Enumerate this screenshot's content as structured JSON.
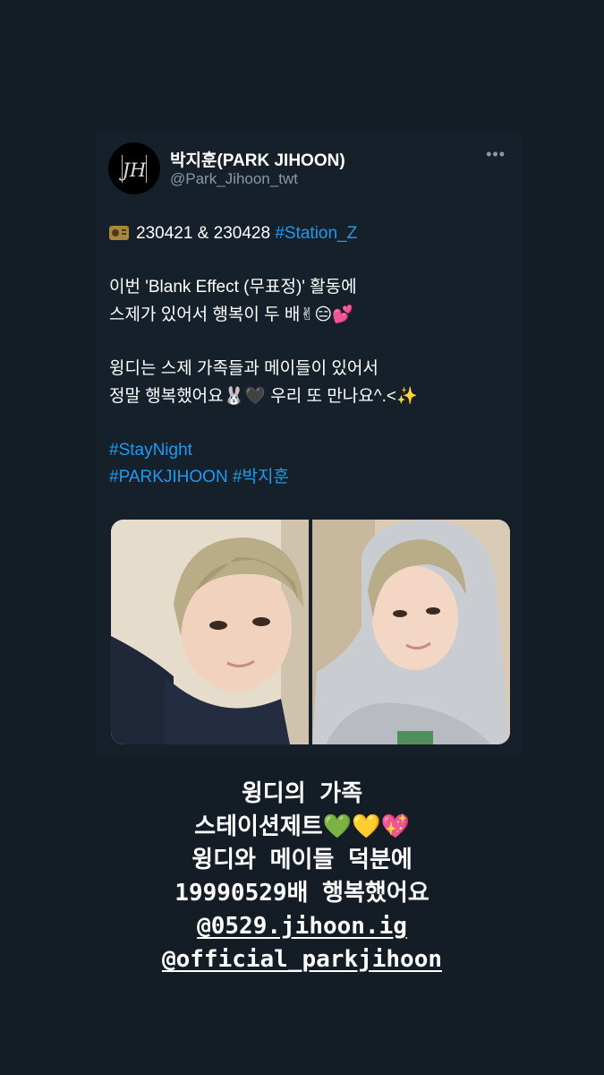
{
  "tweet": {
    "author": {
      "name": "박지훈(PARK JIHOON)",
      "handle": "@Park_Jihoon_twt",
      "avatar_monogram": "JH"
    },
    "more_icon": "more-horizontal-icon",
    "text": {
      "date_line": "230421 & 230428",
      "date_hashtag": "#Station_Z",
      "para1_line1": "이번 'Blank Effect (무표정)' 활동에",
      "para1_line2": "스제가 있어서 행복이 두 배",
      "para1_emojis": "✌😑💕",
      "para2_line1": "윙디는 스제 가족들과 메이들이 있어서",
      "para2_line2a": "정말 행복했어요",
      "para2_emojis": "🐰🖤",
      "para2_line2b": "우리 또 만나요^.<",
      "para2_sparkle": "✨",
      "hashtag1": "#StayNight",
      "hashtag2": "#PARKJIHOON",
      "hashtag3": "#박지훈"
    },
    "media": [
      {
        "name": "photo-selfie-navy-hoodie"
      },
      {
        "name": "photo-selfie-grey-hoodie"
      }
    ]
  },
  "story_caption": {
    "line1": "윙디의 가족",
    "line2_text": "스테이션제트",
    "line2_emojis": "💚💛💖",
    "line3": "윙디와 메이들 덕분에",
    "line4": "19990529배 행복했어요",
    "mention1": "@0529.jihoon.ig",
    "mention2": "@official_parkjihoon"
  },
  "colors": {
    "background": "#141d26",
    "card": "#15202b",
    "link": "#1d9bf0",
    "secondary_text": "#8899a6"
  }
}
